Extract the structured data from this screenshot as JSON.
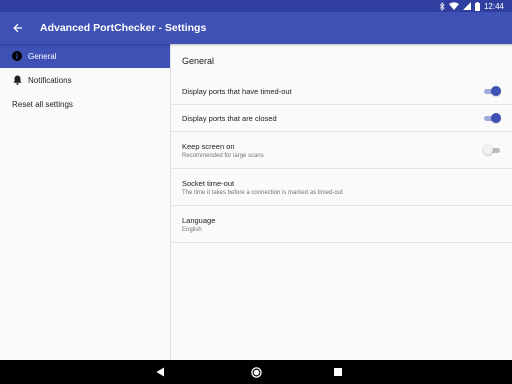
{
  "status": {
    "time": "12:44",
    "icons": [
      "bluetooth-icon",
      "wifi-icon",
      "signal-icon",
      "battery-icon"
    ]
  },
  "appbar": {
    "title": "Advanced PortChecker - Settings",
    "back_icon": "arrow-back-icon"
  },
  "sidebar": {
    "items": [
      {
        "label": "General",
        "icon": "info-icon",
        "selected": true
      },
      {
        "label": "Notifications",
        "icon": "bell-icon",
        "selected": false
      },
      {
        "label": "Reset all settings"
      }
    ]
  },
  "content": {
    "section_title": "General",
    "prefs": [
      {
        "title": "Display ports that have timed-out",
        "toggle": "on"
      },
      {
        "title": "Display ports that are closed",
        "toggle": "on"
      },
      {
        "title": "Keep screen on",
        "summary": "Recommended for large scans",
        "toggle": "off"
      },
      {
        "title": "Socket time-out",
        "summary": "The time it takes before a connection is marked as timed-out"
      },
      {
        "title": "Language",
        "summary": "English"
      }
    ]
  },
  "colors": {
    "primary": "#3f51b5",
    "primary_dark": "#303f9f",
    "accent_track": "#9fa8da"
  },
  "navbar": {
    "icons": [
      "back-triangle-icon",
      "home-circle-icon",
      "recents-square-icon"
    ]
  }
}
